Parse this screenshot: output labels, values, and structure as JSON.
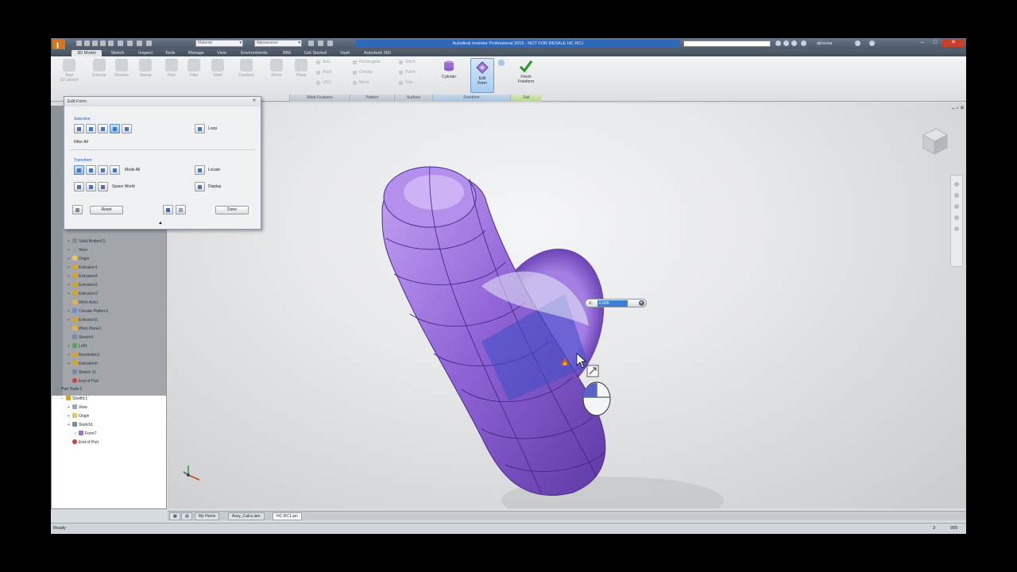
{
  "window": {
    "title": "Autodesk Inventor Professional 2015 - NOT FOR RESALE   HC-RC1",
    "qat_material": "Material",
    "qat_appearance": "Appearance",
    "user": "djmcma"
  },
  "tabs": [
    "3D Model",
    "Sketch",
    "Inspect",
    "Tools",
    "Manage",
    "View",
    "Environments",
    "BIM",
    "Get Started",
    "Vault",
    "Autodesk 360"
  ],
  "ribbon": {
    "start_sketch": "Start\n2D Sketch",
    "extrude": "Extrude",
    "revolve": "Revolve",
    "sweep": "Sweep",
    "hole": "Hole",
    "fillet": "Fillet",
    "shell": "Shell",
    "combine": "Combine",
    "direct": "Direct",
    "plane": "Plane",
    "axis": "Axis",
    "point": "Point",
    "ucs": "UCS",
    "rectangular": "Rectangular",
    "circular": "Circular",
    "mirror": "Mirror",
    "stitch": "Stitch",
    "patch": "Patch",
    "trim": "Trim",
    "cylinder": "Cylinder",
    "edit_form": "Edit\nForm",
    "finish_freeform": "Finish\nFreeform",
    "groups": {
      "work_features": "Work Features",
      "pattern": "Pattern",
      "surface": "Surface",
      "freeform": "Freeform",
      "exit": "Exit"
    }
  },
  "dialog": {
    "title": "Edit Form",
    "selection_label": "Selection",
    "loop": "Loop",
    "filter": "Filter All",
    "transform_label": "Transform",
    "mode": "Mode All",
    "space": "Space World",
    "locate": "Locate",
    "display": "Display",
    "reset": "Reset",
    "done": "Done"
  },
  "browser": {
    "gray_items": [
      "Solid Bodies(1)",
      "View",
      "Origin",
      "Extrusion1",
      "Extrusion4",
      "Extrusion2",
      "Extrusion3",
      "Work Axis1",
      "Circular Pattern1",
      "Extrusion5",
      "Work Plane1",
      "Sketch4",
      "Loft1",
      "Revolution1",
      "Extrusion6",
      "Sketch 11",
      "End of Part"
    ],
    "section_header": "Part Tools:1",
    "white_items": [
      "Shellfit:1",
      "View",
      "Origin",
      "Sketch1",
      "Form7",
      "End of Part"
    ]
  },
  "viewport": {
    "value_label": "X:",
    "value": "0.000"
  },
  "doc_tabs": [
    "My Home",
    "Assy_Calcs.iam",
    "HC-RC1.ipn"
  ],
  "status": {
    "left": "Ready",
    "right_count": "3",
    "right_value": "999"
  },
  "colors": {
    "form_body": "#8a5fd0",
    "title_highlight": "#2f68b8",
    "app_accent": "#d4761c"
  }
}
